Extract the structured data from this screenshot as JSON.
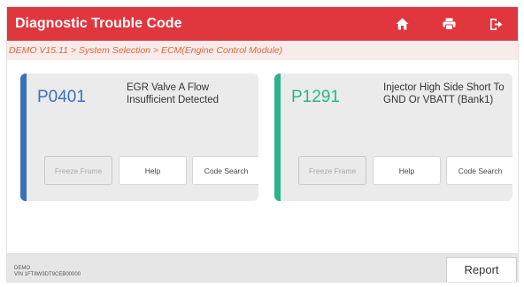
{
  "header": {
    "title": "Diagnostic Trouble Code",
    "icons": [
      "home-icon",
      "print-icon",
      "exit-icon"
    ]
  },
  "breadcrumb": "DEMO V15.11 > System Selection > ECM(Engine Control Module)",
  "colors": {
    "header": "#e0363e",
    "breadcrumb_text": "#e2663c",
    "card1_accent": "#3a70c0",
    "card2_accent": "#2bb38c"
  },
  "dtcs": [
    {
      "code": "P0401",
      "description": "EGR Valve A Flow Insufficient Detected",
      "buttons": {
        "freeze_frame": "Freeze Frame",
        "help": "Help",
        "code_search": "Code Search"
      }
    },
    {
      "code": "P1291",
      "description": "Injector High Side Short To GND Or VBATT (Bank1)",
      "buttons": {
        "freeze_frame": "Freeze Frame",
        "help": "Help",
        "code_search": "Code Search"
      }
    }
  ],
  "footer": {
    "vehicle_line1": "DEMO",
    "vehicle_line2": "VIN 1FT8W3DT9CEB00000",
    "report_label": "Report"
  }
}
